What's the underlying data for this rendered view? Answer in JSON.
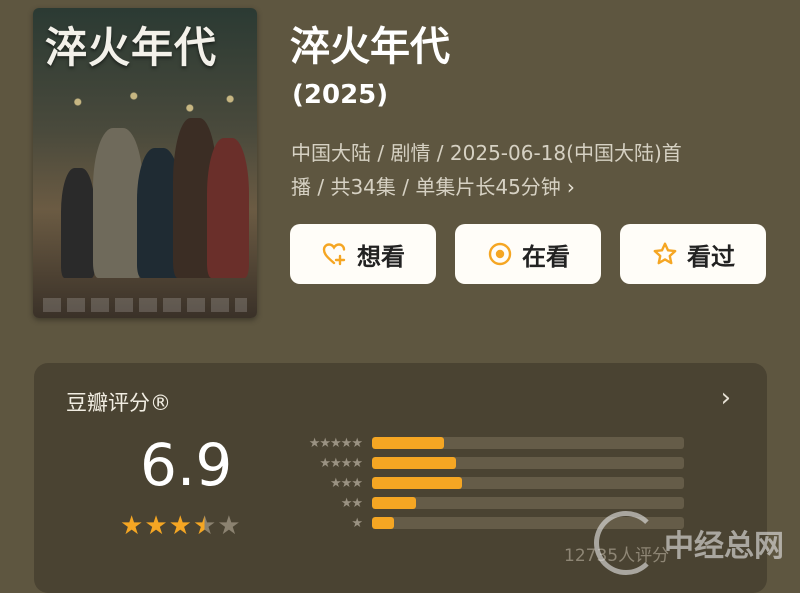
{
  "poster": {
    "title": "淬火年代"
  },
  "header": {
    "title": "淬火年代",
    "year": "(2025)",
    "meta_line1": "中国大陆 / 剧情 / 2025-06-18(中国大陆)首",
    "meta_line2": "播 / 共34集 / 单集片长45分钟",
    "meta_chevron": "›"
  },
  "actions": [
    {
      "label": "想看",
      "icon": "heart-plus-icon"
    },
    {
      "label": "在看",
      "icon": "target-icon"
    },
    {
      "label": "看过",
      "icon": "star-outline-icon"
    }
  ],
  "rating": {
    "label": "豆瓣评分®",
    "score": "6.9",
    "stars": {
      "full": 3,
      "half": 1,
      "empty": 1
    },
    "distribution": [
      {
        "stars": "★★★★★",
        "fraction": 0.23
      },
      {
        "stars": "★★★★",
        "fraction": 0.27
      },
      {
        "stars": "★★★",
        "fraction": 0.29
      },
      {
        "stars": "★★",
        "fraction": 0.14
      },
      {
        "stars": "★",
        "fraction": 0.07
      }
    ],
    "count": "12735人评分",
    "chevron": "›"
  },
  "watermark": {
    "text": "中经总网"
  },
  "colors": {
    "accent": "#f5a623",
    "background": "#5e5640",
    "card": "#4a4332"
  }
}
